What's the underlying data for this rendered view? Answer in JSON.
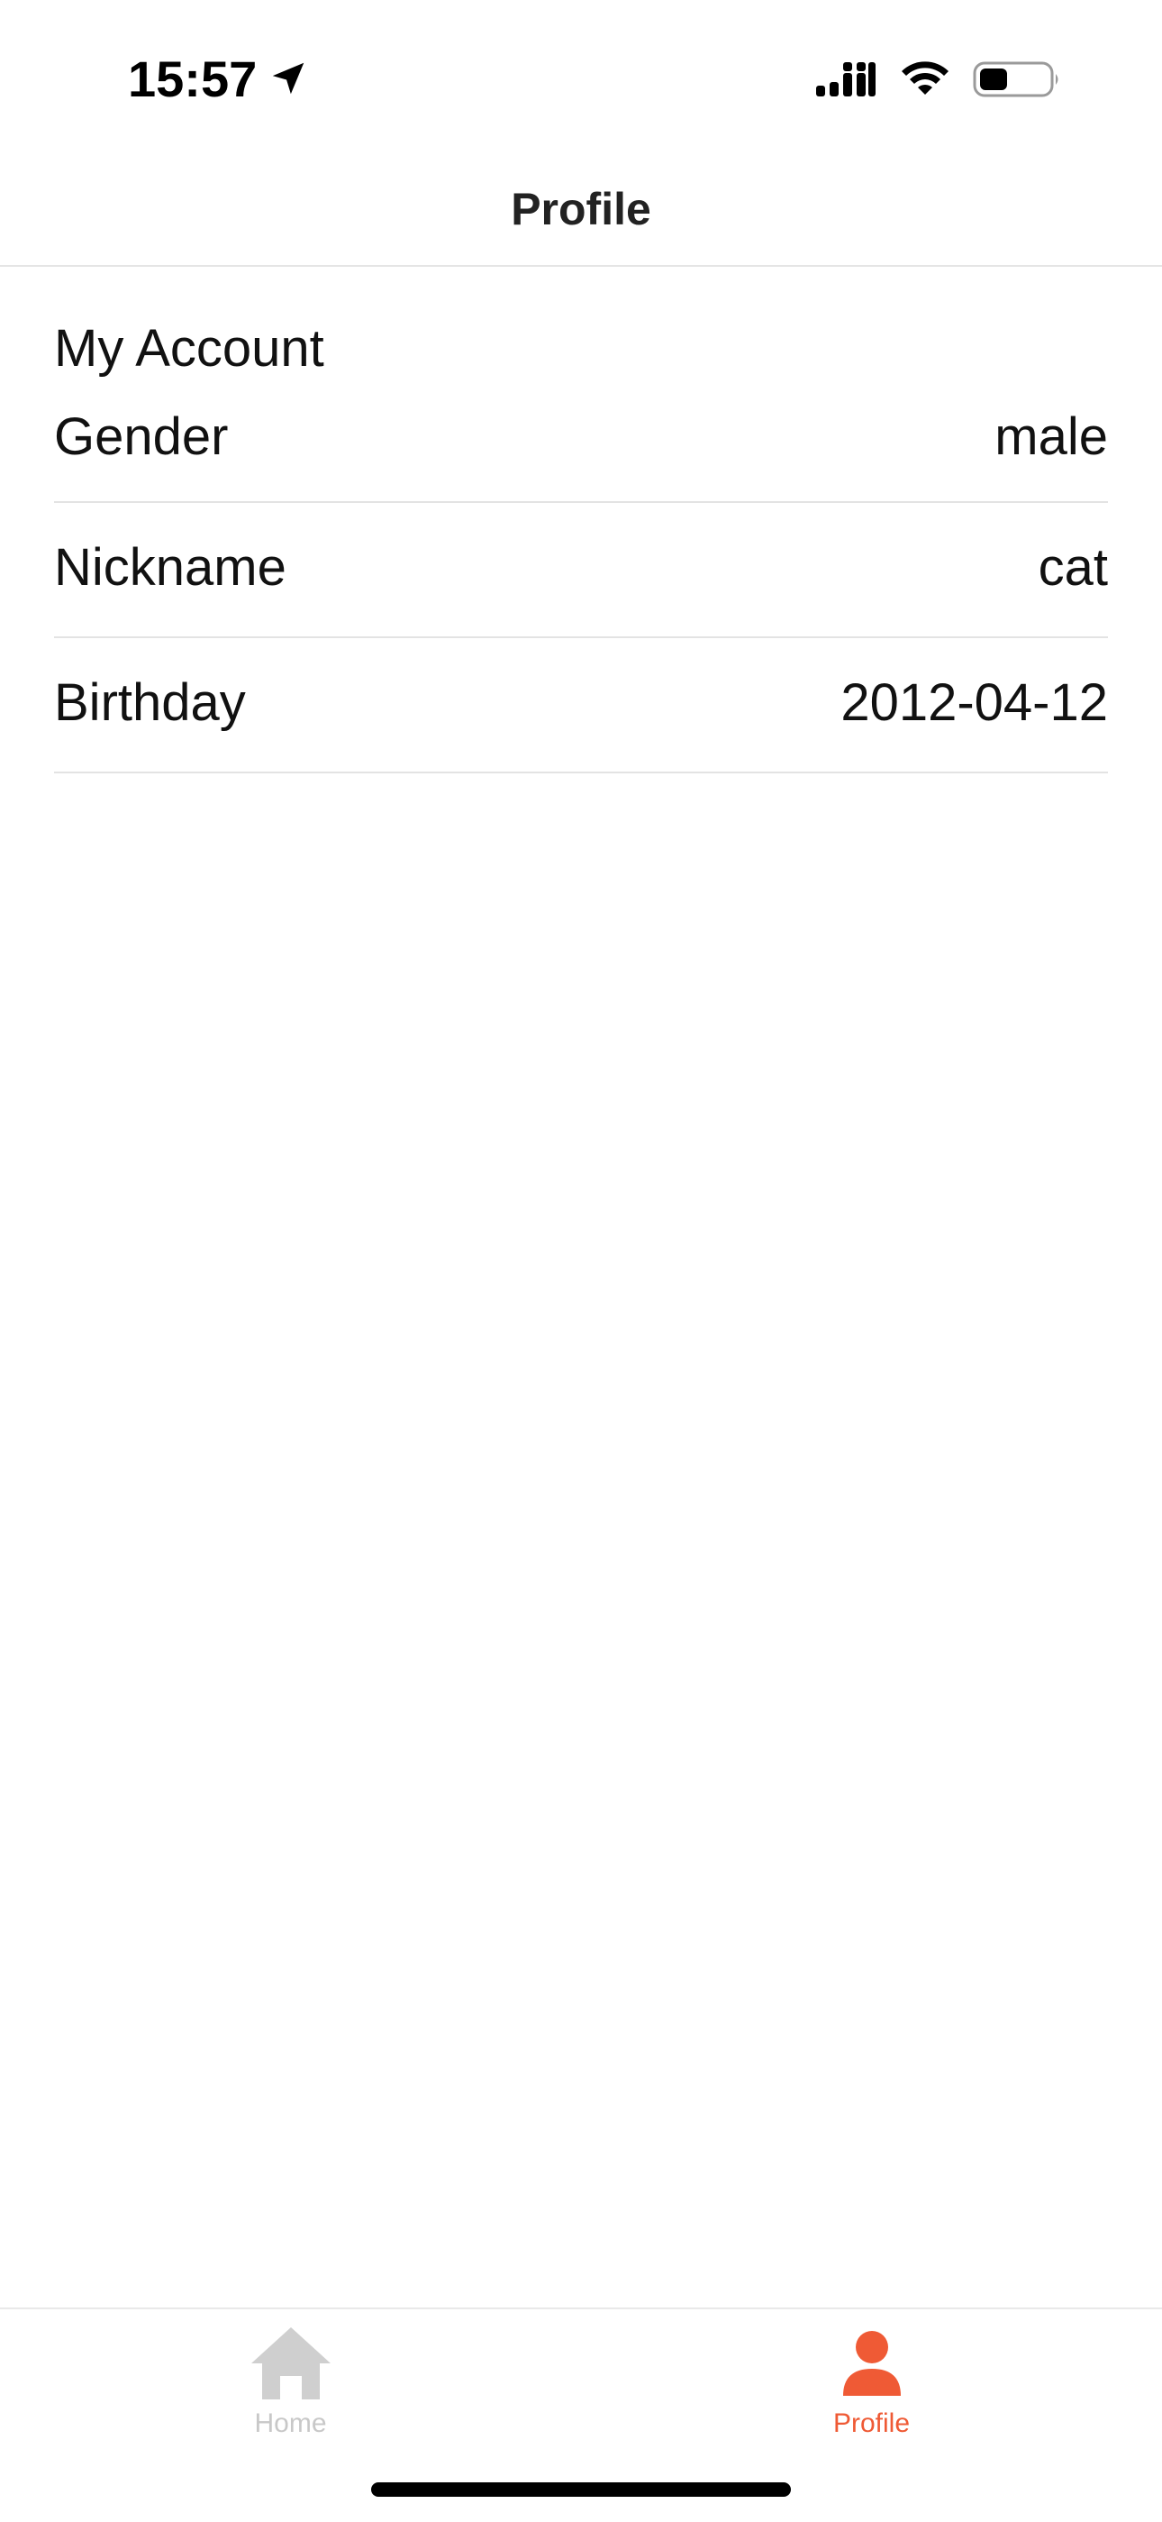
{
  "status_bar": {
    "time": "15:57"
  },
  "header": {
    "title": "Profile"
  },
  "account": {
    "section_title": "My Account",
    "rows": [
      {
        "label": "Gender",
        "value": "male"
      },
      {
        "label": "Nickname",
        "value": "cat"
      },
      {
        "label": "Birthday",
        "value": "2012-04-12"
      }
    ]
  },
  "tab_bar": {
    "tabs": [
      {
        "label": "Home",
        "icon": "home-icon",
        "active": false
      },
      {
        "label": "Profile",
        "icon": "person-icon",
        "active": true
      }
    ],
    "active_color": "#ef5a35",
    "inactive_color": "#c8c8c8"
  }
}
